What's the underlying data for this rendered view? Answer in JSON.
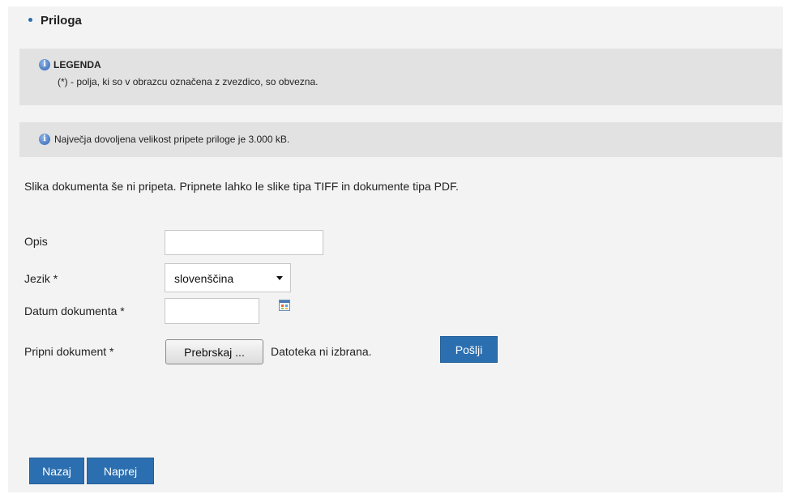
{
  "section": {
    "title": "Priloga"
  },
  "legend": {
    "title": "LEGENDA",
    "text": "(*) - polja, ki so v obrazcu označena z zvezdico, so obvezna."
  },
  "size_info": {
    "text": "Največja dovoljena velikost pripete priloge je 3.000 kB."
  },
  "notice": "Slika dokumenta še ni pripeta. Pripnete lahko le slike tipa TIFF in dokumente tipa PDF.",
  "form": {
    "opis_label": "Opis",
    "opis_value": "",
    "jezik_label": "Jezik *",
    "jezik_selected": "slovenščina",
    "datum_label": "Datum dokumenta *",
    "datum_value": "",
    "pripni_label": "Pripni dokument *",
    "browse_label": "Prebrskaj ...",
    "file_status": "Datoteka ni izbrana.",
    "send_label": "Pošlji"
  },
  "nav": {
    "back_label": "Nazaj",
    "next_label": "Naprej"
  },
  "icons": {
    "info": "info-icon",
    "calendar": "calendar-icon",
    "dropdown": "chevron-down-icon"
  },
  "colors": {
    "button_blue": "#2c6fb0",
    "info_box_bg": "#e2e2e2",
    "panel_bg": "#f3f3f3"
  }
}
